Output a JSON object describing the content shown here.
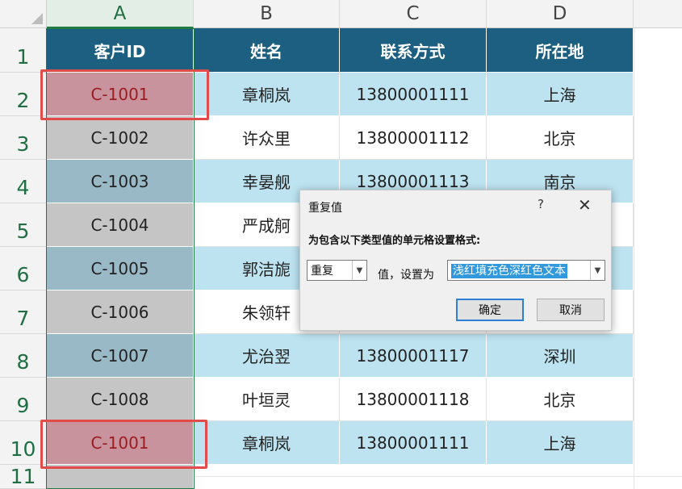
{
  "sheet": {
    "columns": [
      "A",
      "B",
      "C",
      "D"
    ],
    "rows": [
      "1",
      "2",
      "3",
      "4",
      "5",
      "6",
      "7",
      "8",
      "9",
      "10",
      "11"
    ],
    "headers": [
      "客户ID",
      "姓名",
      "联系方式",
      "所在地"
    ],
    "data": [
      [
        "C-1001",
        "章桐岚",
        "13800001111",
        "上海"
      ],
      [
        "C-1002",
        "许众里",
        "13800001112",
        "北京"
      ],
      [
        "C-1003",
        "幸晏舰",
        "13800001113",
        "南京"
      ],
      [
        "C-1004",
        "严成舸",
        "",
        ""
      ],
      [
        "C-1005",
        "郭洁旎",
        "",
        ""
      ],
      [
        "C-1006",
        "朱领轩",
        "",
        ""
      ],
      [
        "C-1007",
        "尤治翌",
        "13800001117",
        "深圳"
      ],
      [
        "C-1008",
        "叶垣灵",
        "13800001118",
        "北京"
      ],
      [
        "C-1001",
        "章桐岚",
        "13800001111",
        "上海"
      ]
    ],
    "duplicate_rows": [
      2,
      10
    ],
    "colors": {
      "header_fill": "#1d5f80",
      "band_blue": "#bde3f1",
      "selected_grey": "#c5c5c5",
      "selected_blue": "#9ab9c7",
      "duplicate_fill": "#c8939c",
      "duplicate_text": "#9c1c22",
      "annotation_red": "#e34b4b",
      "selection_green": "#1f7a43"
    }
  },
  "dialog": {
    "title": "重复值",
    "help": "?",
    "close": "✕",
    "prompt": "为包含以下类型值的单元格设置格式:",
    "type_value": "重复",
    "middle_label": "值，设置为",
    "format_value": "浅红填充色深红色文本",
    "ok_label": "确定",
    "cancel_label": "取消"
  }
}
